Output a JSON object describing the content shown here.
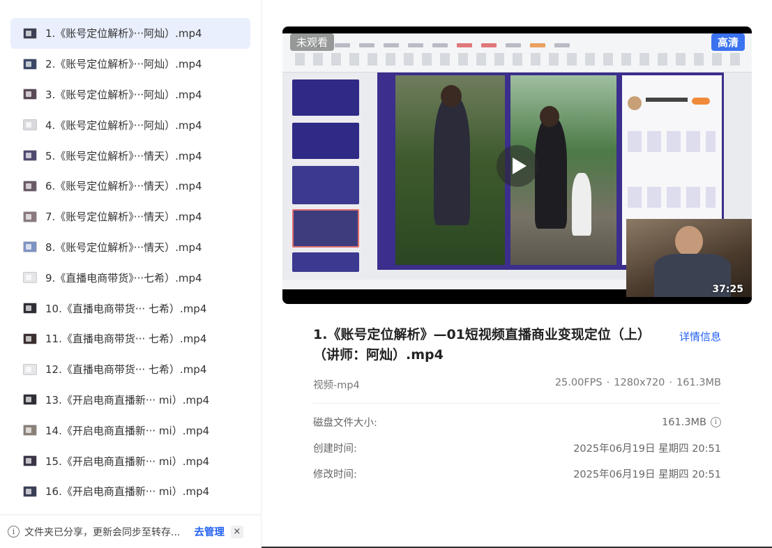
{
  "sidebar": {
    "files": [
      {
        "label": "1.《账号定位解析》···阿灿）.mp4",
        "thumb_color": "#3d3f55",
        "active": true
      },
      {
        "label": "2.《账号定位解析》···阿灿）.mp4",
        "thumb_color": "#3a4766"
      },
      {
        "label": "3.《账号定位解析》···阿灿）.mp4",
        "thumb_color": "#5a4a55"
      },
      {
        "label": "4.《账号定位解析》···阿灿）.mp4",
        "thumb_color": "#d9d9dd"
      },
      {
        "label": "5.《账号定位解析》···情天）.mp4",
        "thumb_color": "#4f4a70"
      },
      {
        "label": "6.《账号定位解析》···情天）.mp4",
        "thumb_color": "#6a5a66"
      },
      {
        "label": "7.《账号定位解析》···情天）.mp4",
        "thumb_color": "#8a7a80"
      },
      {
        "label": "8.《账号定位解析》···情天）.mp4",
        "thumb_color": "#7c93c4"
      },
      {
        "label": "9.《直播电商带货》···七希）.mp4",
        "thumb_color": "#e6e6e9"
      },
      {
        "label": "10.《直播电商带货··· 七希）.mp4",
        "thumb_color": "#2e2e35"
      },
      {
        "label": "11.《直播电商带货··· 七希）.mp4",
        "thumb_color": "#3a2e2e"
      },
      {
        "label": "12.《直播电商带货··· 七希）.mp4",
        "thumb_color": "#e6e6e9"
      },
      {
        "label": "13.《开启电商直播新··· mi）.mp4",
        "thumb_color": "#2f2f36"
      },
      {
        "label": "14.《开启电商直播新··· mi）.mp4",
        "thumb_color": "#8a8078"
      },
      {
        "label": "15.《开启电商直播新··· mi）.mp4",
        "thumb_color": "#3b3548"
      },
      {
        "label": "16.《开启电商直播新··· mi）.mp4",
        "thumb_color": "#3a3f55"
      }
    ],
    "notice": {
      "icon": "info-icon",
      "text": "文件夹已分享，更新会同步至转存...",
      "manage_label": "去管理",
      "close_label": "×"
    }
  },
  "player": {
    "badge_status": "未观看",
    "badge_quality": "高清",
    "duration": "37:25",
    "play_icon": "play-icon"
  },
  "detail": {
    "title": "1.《账号定位解析》—01短视频直播商业变现定位（上）（讲师：阿灿）.mp4",
    "detail_link": "详情信息",
    "type": "视频-mp4",
    "fps": "25.00FPS",
    "resolution": "1280x720",
    "size": "161.3MB",
    "fields": [
      {
        "key": "磁盘文件大小:",
        "value": "161.3MB"
      },
      {
        "key": "创建时间:",
        "value": "2025年06月19日 星期四 20:51"
      },
      {
        "key": "修改时间:",
        "value": "2025年06月19日 星期四 20:51"
      }
    ]
  },
  "colors": {
    "accent": "#2160f0",
    "active_row": "#e9effc",
    "hd_badge": "#3a72f0"
  }
}
